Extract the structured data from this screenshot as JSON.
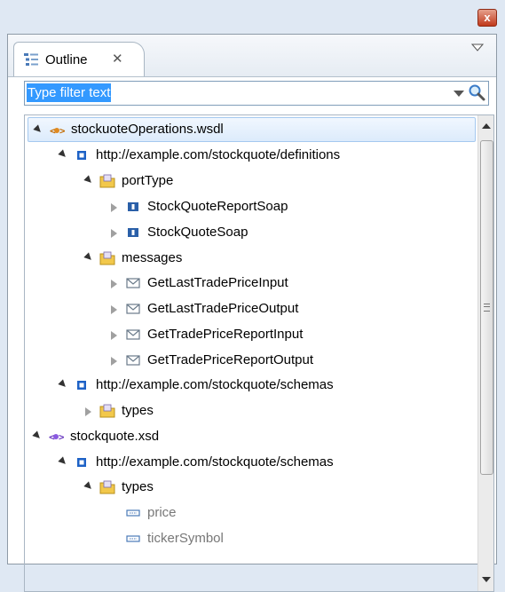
{
  "window": {
    "close_glyph": "x"
  },
  "view": {
    "tab_label": "Outline",
    "tab_close_glyph": "✕",
    "menu_icon": "chevron-down-icon"
  },
  "filter": {
    "placeholder": "Type filter text"
  },
  "tree": {
    "rows": [
      {
        "label": "stockuoteOperations.wsdl",
        "icon": "wsdl-file-icon",
        "expanded": true,
        "selected": true
      },
      {
        "label": "http://example.com/stockquote/definitions",
        "icon": "namespace-icon",
        "expanded": true
      },
      {
        "label": "portType",
        "icon": "folder-icon",
        "expanded": true
      },
      {
        "label": "StockQuoteReportSoap",
        "icon": "interface-icon",
        "expanded": false
      },
      {
        "label": "StockQuoteSoap",
        "icon": "interface-icon",
        "expanded": false
      },
      {
        "label": "messages",
        "icon": "folder-icon",
        "expanded": true
      },
      {
        "label": "GetLastTradePriceInput",
        "icon": "message-icon",
        "expanded": false
      },
      {
        "label": "GetLastTradePriceOutput",
        "icon": "message-icon",
        "expanded": false
      },
      {
        "label": "GetTradePriceReportInput",
        "icon": "message-icon",
        "expanded": false
      },
      {
        "label": "GetTradePriceReportOutput",
        "icon": "message-icon",
        "expanded": false
      },
      {
        "label": "http://example.com/stockquote/schemas",
        "icon": "namespace-icon",
        "expanded": true
      },
      {
        "label": "types",
        "icon": "folder-icon",
        "expanded": false
      },
      {
        "label": "stockquote.xsd",
        "icon": "xsd-file-icon",
        "expanded": true
      },
      {
        "label": "http://example.com/stockquote/schemas",
        "icon": "namespace-icon",
        "expanded": true
      },
      {
        "label": "types",
        "icon": "folder-icon",
        "expanded": true
      },
      {
        "label": "price",
        "icon": "element-icon"
      },
      {
        "label": "tickerSymbol",
        "icon": "element-icon"
      }
    ]
  },
  "colors": {
    "selection_bg": "#dcebfc",
    "filter_highlight": "#3399ff"
  }
}
